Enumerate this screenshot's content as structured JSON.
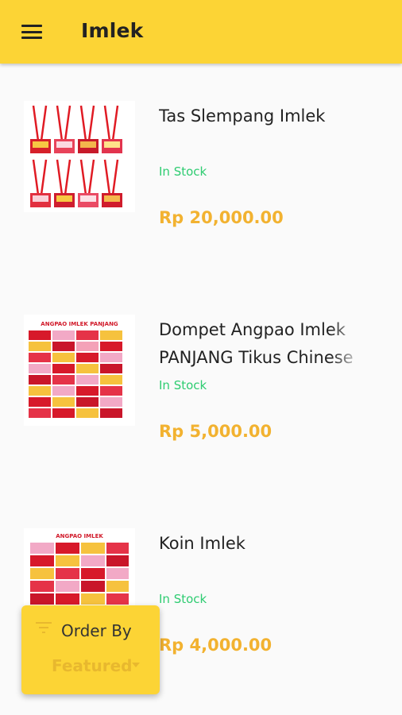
{
  "app_bar": {
    "title": "Imlek",
    "menu_icon": "hamburger-menu-icon",
    "background": "#fcd435"
  },
  "products": [
    {
      "name": "Tas Slempang Imlek",
      "stock": "In Stock",
      "price": "Rp 20,000.00",
      "image": "red-lanyard-pouches-grid"
    },
    {
      "name": "Dompet Angpao Imlek PANJANG Tikus Chinese",
      "stock": "In Stock",
      "price": "Rp 5,000.00",
      "image": "long-red-envelope-assortment",
      "image_caption": "ANGPAO IMLEK PANJANG"
    },
    {
      "name": "Koin Imlek",
      "stock": "In Stock",
      "price": "Rp 4,000.00",
      "image": "red-envelope-assortment",
      "image_caption": "ANGPAO IMLEK"
    }
  ],
  "order_by": {
    "label": "Order By",
    "selected": "Featured",
    "icon": "filter-icon"
  },
  "colors": {
    "accent": "#fcd435",
    "stock_green": "#2ecc71",
    "price_orange": "#f2b230"
  }
}
